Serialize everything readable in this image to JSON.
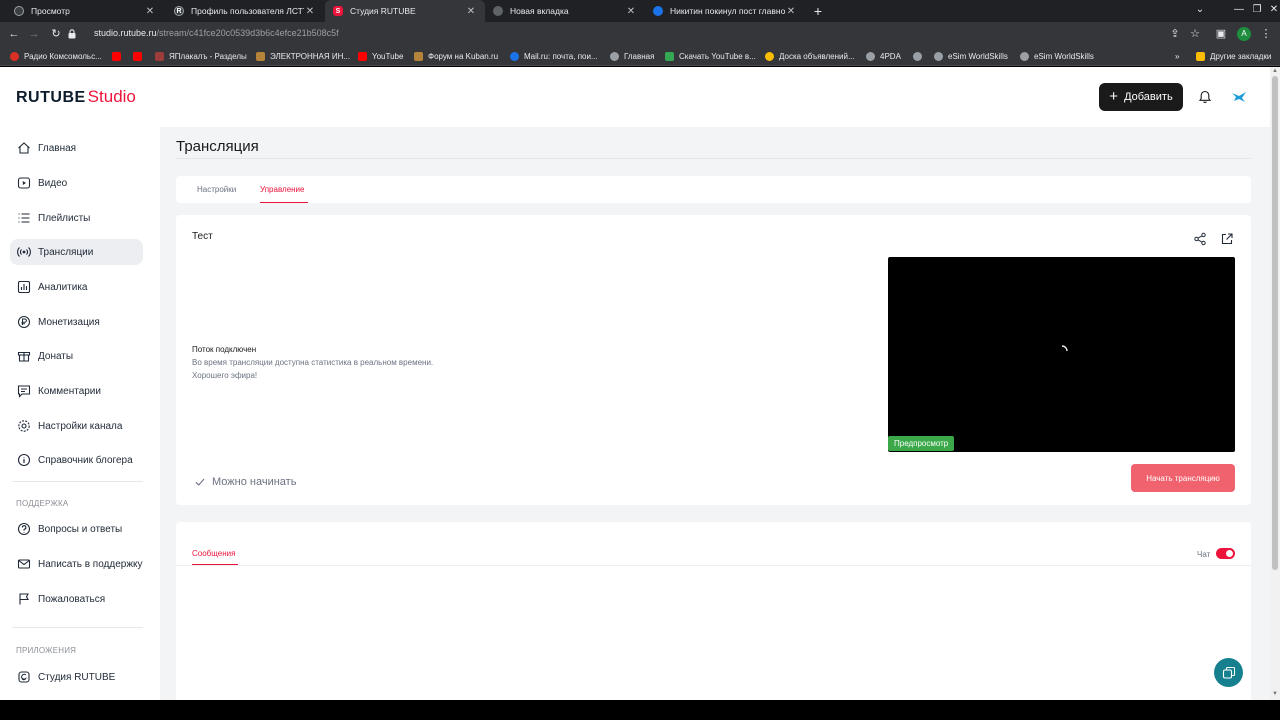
{
  "browser": {
    "tabs": [
      {
        "title": "Просмотр",
        "favicon_color": "#3c4043"
      },
      {
        "title": "Профиль пользователя ЛСТТ",
        "favicon_color": "#3c4043"
      },
      {
        "title": "Студия RUTUBE",
        "favicon_color": "#ed143b"
      },
      {
        "title": "Новая вкладка",
        "favicon_color": "#5f6368"
      },
      {
        "title": "Никитин покинул пост главного",
        "favicon_color": "#1a73e8"
      }
    ],
    "url_host": "studio.rutube.ru",
    "url_path": "/stream/c41fce20c0539d3b6c4efce21b508c5f",
    "profile_letter": "A",
    "bookmarks": [
      {
        "label": "Радио Комсомольс...",
        "color": "#d93025"
      },
      {
        "label": "",
        "color": "#ff0000"
      },
      {
        "label": "ЯПлакалъ - Разделы",
        "color": "#9e3c3c"
      },
      {
        "label": "ЭЛЕКТРОННАЯ ИН...",
        "color": "#b5843a"
      },
      {
        "label": "YouTube",
        "color": "#ff0000"
      },
      {
        "label": "Форум на Kuban.ru",
        "color": "#b5843a"
      },
      {
        "label": "Mail.ru: почта, пои...",
        "color": "#1a73e8"
      },
      {
        "label": "Главная",
        "color": "#9aa0a6"
      },
      {
        "label": "Скачать YouTube в...",
        "color": "#34a853"
      },
      {
        "label": "Доска объявлений...",
        "color": "#fbbc04"
      },
      {
        "label": "4PDA",
        "color": "#9aa0a6"
      },
      {
        "label": "eSim WorldSkills",
        "color": "#9aa0a6"
      },
      {
        "label": "eSim WorldSkills",
        "color": "#9aa0a6"
      }
    ],
    "other_bookmarks": "Другие закладки"
  },
  "header": {
    "logo_main": "RUTUBE",
    "logo_sub": "Studio",
    "add_label": "Добавить"
  },
  "sidebar": {
    "items": [
      {
        "label": "Главная",
        "icon": "home-icon"
      },
      {
        "label": "Видео",
        "icon": "video-icon"
      },
      {
        "label": "Плейлисты",
        "icon": "playlist-icon"
      },
      {
        "label": "Трансляции",
        "icon": "broadcast-icon",
        "active": true
      },
      {
        "label": "Аналитика",
        "icon": "analytics-icon"
      },
      {
        "label": "Монетизация",
        "icon": "monetization-icon"
      },
      {
        "label": "Донаты",
        "icon": "donate-icon"
      },
      {
        "label": "Комментарии",
        "icon": "comments-icon"
      },
      {
        "label": "Настройки канала",
        "icon": "settings-icon"
      },
      {
        "label": "Справочник блогера",
        "icon": "info-icon"
      }
    ],
    "support_title": "ПОДДЕРЖКА",
    "support_items": [
      {
        "label": "Вопросы и ответы",
        "icon": "question-icon"
      },
      {
        "label": "Написать в поддержку",
        "icon": "mail-icon"
      },
      {
        "label": "Пожаловаться",
        "icon": "flag-icon"
      }
    ],
    "apps_title": "ПРИЛОЖЕНИЯ",
    "apps_items": [
      {
        "label": "Студия RUTUBE",
        "icon": "studio-app-icon"
      }
    ]
  },
  "main": {
    "title": "Трансляция",
    "tabs": [
      {
        "label": "Настройки"
      },
      {
        "label": "Управление",
        "active": true
      }
    ],
    "stream_name": "Тест",
    "status_title": "Поток подключен",
    "status_lines": [
      "Во время трансляции доступна статистика в реальном времени.",
      "Хорошего эфира!"
    ],
    "preview_badge": "Предпросмотр",
    "ready_label": "Можно начинать",
    "start_label": "Начать трансляцию"
  },
  "chat": {
    "tab_label": "Сообщения",
    "toggle_label": "Чат",
    "toggle_on": true
  },
  "colors": {
    "accent": "#ed143b",
    "start_button": "#f0626e",
    "preview_badge": "#3ba84a",
    "help_fab": "#16808f"
  }
}
